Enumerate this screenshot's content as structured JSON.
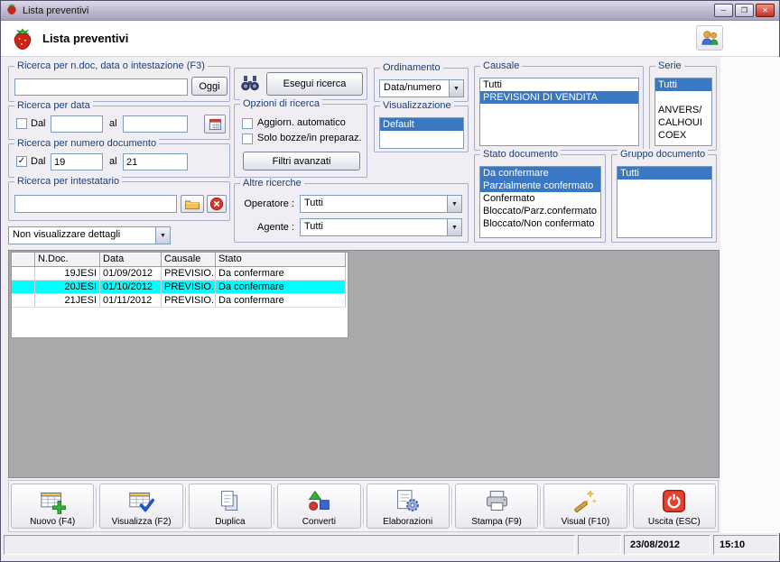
{
  "window": {
    "title": "Lista preventivi",
    "controls": {
      "minimize": "─",
      "maximize": "❐",
      "close": "✕"
    }
  },
  "header": {
    "title": "Lista preventivi"
  },
  "filters": {
    "search": {
      "label": "Ricerca per n.doc, data o intestazione (F3)",
      "value": "",
      "today_button": "Oggi"
    },
    "date": {
      "label": "Ricerca per data",
      "dal_label": "Dal",
      "dal_checked": "",
      "from_value": "",
      "al_label": "al",
      "to_value": ""
    },
    "docnum": {
      "label": "Ricerca per numero documento",
      "dal_label": "Dal",
      "dal_checked": "✓",
      "from_value": "19",
      "al_label": "al",
      "to_value": "21"
    },
    "intestatario": {
      "label": "Ricerca per intestatario",
      "value": ""
    },
    "detail_combo": {
      "value": "Non visualizzare dettagli"
    }
  },
  "search_actions": {
    "esegui_button": "Esegui ricerca",
    "opzioni": {
      "label": "Opzioni di ricerca",
      "auto_refresh": {
        "label": "Aggiorn. automatico",
        "checked": ""
      },
      "drafts_only": {
        "label": "Solo bozze/in preparaz.",
        "checked": ""
      },
      "filtri_button": "Filtri avanzati"
    },
    "altre": {
      "label": "Altre ricerche",
      "operatore_label": "Operatore :",
      "operatore_value": "Tutti",
      "agente_label": "Agente :",
      "agente_value": "Tutti"
    }
  },
  "ordinamento": {
    "label": "Ordinamento",
    "value": "Data/numero"
  },
  "visualizzazione": {
    "label": "Visualizzazione",
    "items": [
      {
        "label": "Default",
        "selected": true
      }
    ]
  },
  "causale": {
    "label": "Causale",
    "items": [
      {
        "label": "Tutti"
      },
      {
        "label": "PREVISIONI DI VENDITA",
        "selected": true
      }
    ]
  },
  "serie": {
    "label": "Serie",
    "items": [
      {
        "label": "Tutti",
        "selected": true
      },
      {
        "label": ""
      },
      {
        "label": "ANVERS/"
      },
      {
        "label": "CALHOUI"
      },
      {
        "label": "COEX"
      }
    ]
  },
  "stato_documento": {
    "label": "Stato documento",
    "items": [
      {
        "label": "Da confermare",
        "selected": true
      },
      {
        "label": "Parzialmente confermato",
        "selected": true
      },
      {
        "label": "Confermato"
      },
      {
        "label": "Bloccato/Parz.confermato"
      },
      {
        "label": "Bloccato/Non confermato"
      }
    ]
  },
  "gruppo_documento": {
    "label": "Gruppo documento",
    "items": [
      {
        "label": "Tutti",
        "selected": true
      }
    ]
  },
  "results_table": {
    "columns": [
      "",
      "N.Doc.",
      "Data",
      "Causale",
      "Stato"
    ],
    "rows": [
      {
        "selected": false,
        "cells": [
          "",
          "19JESI",
          "01/09/2012",
          "PREVISIO...",
          "Da confermare"
        ]
      },
      {
        "selected": true,
        "cells": [
          "",
          "20JESI",
          "01/10/2012",
          "PREVISIO...",
          "Da confermare"
        ]
      },
      {
        "selected": false,
        "cells": [
          "",
          "21JESI",
          "01/11/2012",
          "PREVISIO...",
          "Da confermare"
        ]
      }
    ]
  },
  "toolbar": {
    "buttons": [
      {
        "label": "Nuovo (F4)",
        "icon": "table-plus-icon"
      },
      {
        "label": "Visualizza (F2)",
        "icon": "table-check-icon"
      },
      {
        "label": "Duplica",
        "icon": "copy-pages-icon"
      },
      {
        "label": "Converti",
        "icon": "convert-shapes-icon"
      },
      {
        "label": "Elaborazioni",
        "icon": "page-gear-icon"
      },
      {
        "label": "Stampa (F9)",
        "icon": "printer-icon"
      },
      {
        "label": "Visual (F10)",
        "icon": "magic-wand-icon"
      },
      {
        "label": "Uscita (ESC)",
        "icon": "power-icon"
      }
    ]
  },
  "statusbar": {
    "date": "23/08/2012",
    "time": "15:10"
  },
  "colors": {
    "selection_blue": "#3a78c3",
    "row_selection_cyan": "#00ffff",
    "accent_red": "#d6392c",
    "titlebar": "#bdb9cd"
  }
}
